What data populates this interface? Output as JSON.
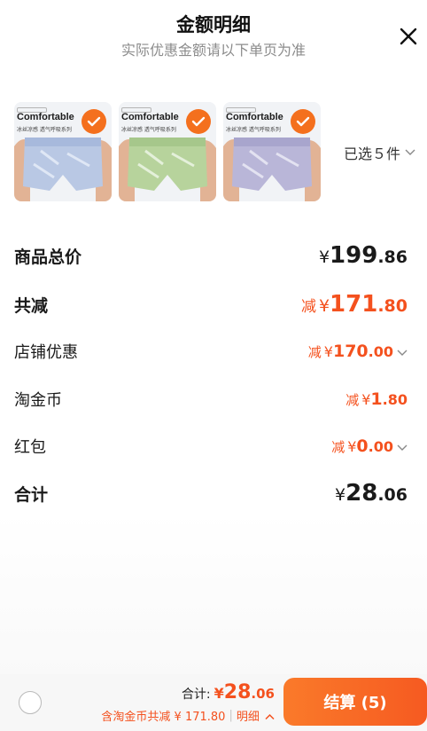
{
  "header": {
    "title": "金额明细",
    "subtitle": "实际优惠金额请以下单页为准"
  },
  "products": [
    {
      "brand_text": "Comfortable",
      "desc_text": "冰丝凉感 透气呼吸系列",
      "color": "#b9c8e4",
      "selected": true
    },
    {
      "brand_text": "Comfortable",
      "desc_text": "冰丝凉感 透气呼吸系列",
      "color": "#b7d39c",
      "selected": true
    },
    {
      "brand_text": "Comfortable",
      "desc_text": "冰丝凉感 透气呼吸系列",
      "color": "#b9b6d8",
      "selected": true
    }
  ],
  "selected_label": "已选５件",
  "rows": [
    {
      "label": "商品总价",
      "prefix": "",
      "yen": "¥",
      "int": "199",
      "dec": ".86",
      "bold_label": true,
      "tone": "black",
      "size": "big",
      "chevron": false
    },
    {
      "label": "共减",
      "prefix": "减",
      "yen": "¥",
      "int": "171",
      "dec": ".80",
      "bold_label": true,
      "tone": "orange",
      "size": "big",
      "chevron": false
    },
    {
      "label": "店铺优惠",
      "prefix": "减",
      "yen": "¥",
      "int": "170",
      "dec": ".00",
      "bold_label": false,
      "tone": "orange",
      "size": "small",
      "chevron": true
    },
    {
      "label": "淘金币",
      "prefix": "减",
      "yen": "¥",
      "int": "1",
      "dec": ".80",
      "bold_label": false,
      "tone": "orange",
      "size": "small",
      "chevron": false
    },
    {
      "label": "红包",
      "prefix": "减",
      "yen": "¥",
      "int": "0",
      "dec": ".00",
      "bold_label": false,
      "tone": "orange",
      "size": "small",
      "chevron": true
    },
    {
      "label": "合计",
      "prefix": "",
      "yen": "¥",
      "int": "28",
      "dec": ".06",
      "bold_label": true,
      "tone": "black",
      "size": "big",
      "chevron": false
    }
  ],
  "footer": {
    "total_label": "合计:",
    "total_yen": "¥",
    "total_int": "28",
    "total_dec": ".06",
    "note_text": "含淘金币共减 ¥ 171.80",
    "separator": "|",
    "detail_label": "明细",
    "pay_label": "结算 (5)"
  },
  "colors": {
    "accent": "#f4511e",
    "check": "#f4701e",
    "pay_start": "#fa7a2a",
    "pay_end": "#f65a21"
  },
  "icons": {
    "close": "close-icon",
    "check": "check-icon",
    "chevron_down": "chevron-down-icon",
    "chevron_up": "chevron-up-icon"
  }
}
